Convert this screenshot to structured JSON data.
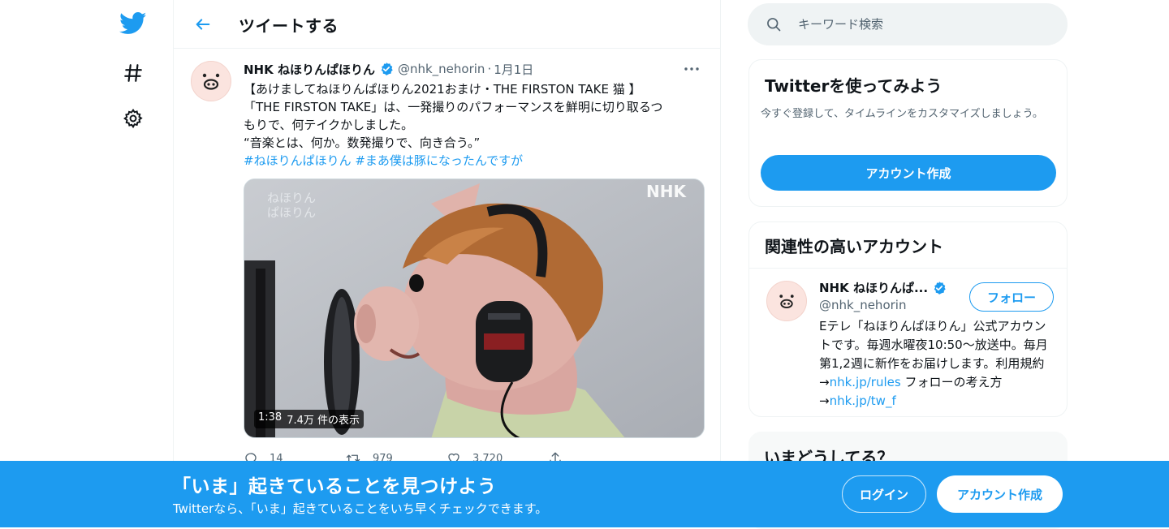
{
  "colors": {
    "accent": "#1d9bf0",
    "text": "#0f1419",
    "muted": "#536471"
  },
  "nav": {
    "icons": [
      "twitter-logo-icon",
      "hashtag-icon",
      "gear-icon"
    ]
  },
  "header": {
    "title": "ツイートする"
  },
  "tweet": {
    "name": "NHK ねほりんぱほりん",
    "handle": "@nhk_nehorin",
    "separator": "·",
    "date": "1月1日",
    "text_lines": [
      "【あけましてねほりんぱほりん2021おまけ・THE FIRSTON TAKE 猫 】",
      "「THE FIRSTON TAKE」は、一発撮りのパフォーマンスを鮮明に切り取るつ",
      "もりで、何テイクかしました。",
      "“音楽とは、何か。数発撮りで、向き合う。”"
    ],
    "hashtags": [
      "#ねほりんぱほりん",
      "#まあ僕は豚になったんですが"
    ],
    "media": {
      "watermark_left": [
        "ねほりん",
        "ぱほりん"
      ],
      "watermark_right": "NHK",
      "duration": "1:38",
      "views": "7.4万 件の表示"
    },
    "stats": {
      "replies": "14",
      "retweets": "979",
      "likes": "3,720"
    }
  },
  "search": {
    "placeholder": "キーワード検索"
  },
  "signup_card": {
    "title": "Twitterを使ってみよう",
    "description": "今すぐ登録して、タイムラインをカスタマイズしましょう。",
    "button": "アカウント作成"
  },
  "related": {
    "title": "関連性の高いアカウント",
    "name": "NHK ねほりんぱ...",
    "handle": "@nhk_nehorin",
    "follow": "フォロー",
    "bio_1": "Eテレ「ねほりんぱほりん」公式アカウントです。毎週水曜夜10:50〜放送中。毎月第1,2週に新作をお届けします。利用規約→",
    "bio_link_1": "nhk.jp/rules",
    "bio_2": " フォローの考え方→",
    "bio_link_2": "nhk.jp/tw_f"
  },
  "trends": {
    "title": "いまどうしてる？"
  },
  "bottom_bar": {
    "title": "「いま」起きていることを見つけよう",
    "subtitle": "Twitterなら、「いま」起きていることをいち早くチェックできます。",
    "login": "ログイン",
    "signup": "アカウント作成"
  }
}
